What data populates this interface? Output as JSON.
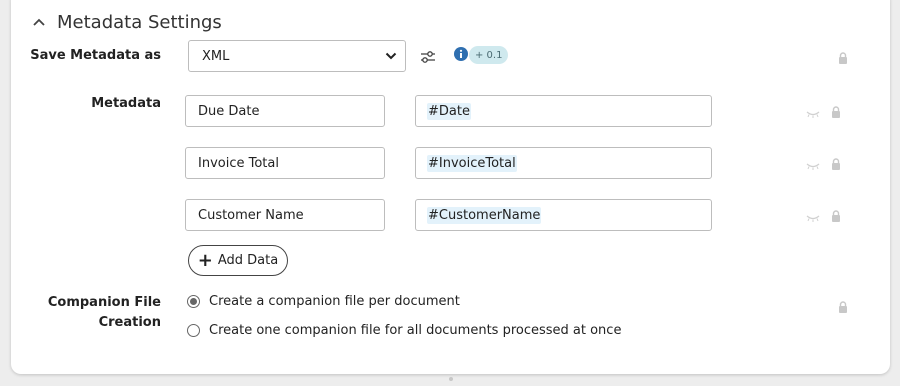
{
  "section": {
    "title": "Metadata Settings",
    "expanded": true
  },
  "save_as": {
    "label": "Save Metadata as",
    "selected": "XML",
    "version_badge": "+ 0.1"
  },
  "metadata": {
    "label": "Metadata",
    "rows": [
      {
        "name": "Due Date",
        "value": "#Date"
      },
      {
        "name": "Invoice Total",
        "value": "#InvoiceTotal"
      },
      {
        "name": "Customer Name",
        "value": "#CustomerName"
      }
    ],
    "add_label": "Add Data"
  },
  "companion": {
    "label_line1": "Companion File",
    "label_line2": "Creation",
    "options": [
      {
        "label": "Create a companion file per document",
        "selected": true
      },
      {
        "label": "Create one companion file for all documents processed at once",
        "selected": false
      }
    ]
  },
  "colors": {
    "accent": "#2f6fb0",
    "tag_bg": "#e3f2fb",
    "badge_bg": "#cfe9ee"
  },
  "icons": [
    "chevron-up-icon",
    "sliders-icon",
    "info-icon",
    "lock-icon",
    "eye-closed-icon",
    "plus-icon",
    "chevron-down-icon"
  ]
}
